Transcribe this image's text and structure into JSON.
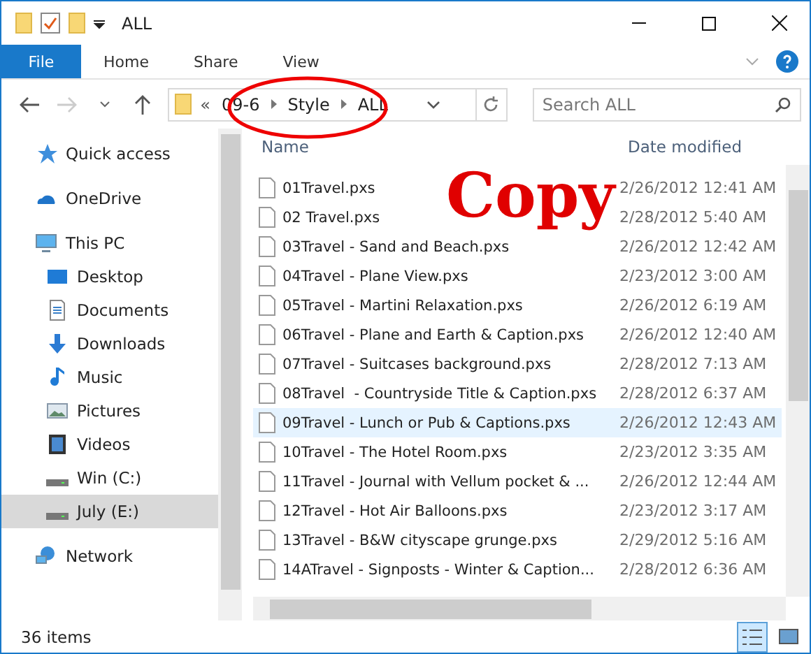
{
  "window": {
    "title": "ALL"
  },
  "ribbon_tabs": [
    {
      "label": "File",
      "selected": true
    },
    {
      "label": "Home",
      "selected": false
    },
    {
      "label": "Share",
      "selected": false
    },
    {
      "label": "View",
      "selected": false
    }
  ],
  "address": {
    "overflow": "«",
    "segments": [
      "09-6",
      "Style",
      "ALL"
    ]
  },
  "search": {
    "placeholder": "Search ALL"
  },
  "sidebar": {
    "items": [
      {
        "label": "Quick access",
        "selected": false
      },
      {
        "label": "OneDrive",
        "selected": false
      },
      {
        "label": "This PC",
        "selected": false,
        "children": [
          {
            "label": "Desktop",
            "selected": false
          },
          {
            "label": "Documents",
            "selected": false
          },
          {
            "label": "Downloads",
            "selected": false
          },
          {
            "label": "Music",
            "selected": false
          },
          {
            "label": "Pictures",
            "selected": false
          },
          {
            "label": "Videos",
            "selected": false
          },
          {
            "label": "Win (C:)",
            "selected": false
          },
          {
            "label": "July (E:)",
            "selected": true
          }
        ]
      },
      {
        "label": "Network",
        "selected": false
      }
    ]
  },
  "table": {
    "columns": [
      "Name",
      "Date modified"
    ],
    "rows": [
      {
        "name": "01Travel.pxs",
        "date": "2/26/2012 12:41 AM",
        "selected": false
      },
      {
        "name": "02 Travel.pxs",
        "date": "2/28/2012 5:40 AM",
        "selected": false
      },
      {
        "name": "03Travel - Sand and Beach.pxs",
        "date": "2/26/2012 12:42 AM",
        "selected": false
      },
      {
        "name": "04Travel - Plane View.pxs",
        "date": "2/23/2012 3:00 AM",
        "selected": false
      },
      {
        "name": "05Travel - Martini Relaxation.pxs",
        "date": "2/26/2012 6:19 AM",
        "selected": false
      },
      {
        "name": "06Travel - Plane and Earth & Caption.pxs",
        "date": "2/26/2012 12:40 AM",
        "selected": false
      },
      {
        "name": "07Travel - Suitcases background.pxs",
        "date": "2/28/2012 7:13 AM",
        "selected": false
      },
      {
        "name": "08Travel  - Countryside Title & Caption.pxs",
        "date": "2/28/2012 6:37 AM",
        "selected": false
      },
      {
        "name": "09Travel - Lunch or Pub & Captions.pxs",
        "date": "2/26/2012 12:43 AM",
        "selected": true
      },
      {
        "name": "10Travel - The Hotel Room.pxs",
        "date": "2/23/2012 3:35 AM",
        "selected": false
      },
      {
        "name": "11Travel - Journal with Vellum pocket & ...",
        "date": "2/26/2012 12:44 AM",
        "selected": false
      },
      {
        "name": "12Travel - Hot Air Balloons.pxs",
        "date": "2/23/2012 3:17 AM",
        "selected": false
      },
      {
        "name": "13Travel - B&W cityscape grunge.pxs",
        "date": "2/29/2012 5:16 AM",
        "selected": false
      },
      {
        "name": "14ATravel - Signposts - Winter & Caption...",
        "date": "2/28/2012 6:36 AM",
        "selected": false
      }
    ]
  },
  "annotation": {
    "text": "Copy"
  },
  "status_bar": {
    "count": "36 items"
  }
}
